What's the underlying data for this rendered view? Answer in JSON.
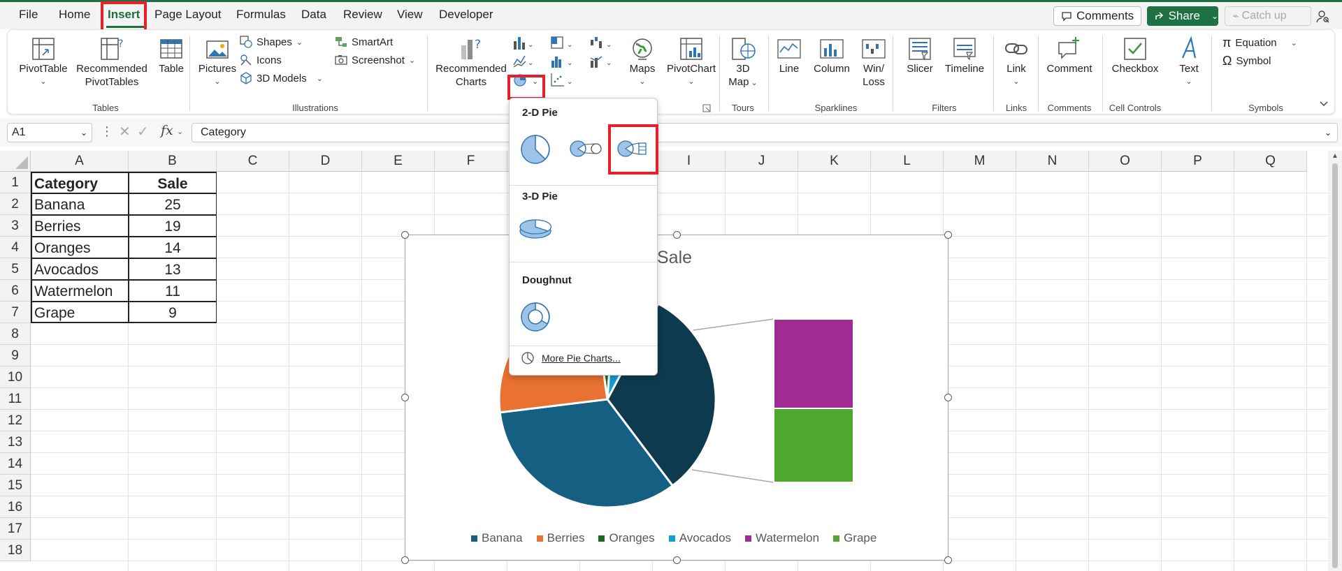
{
  "menu": {
    "tabs": [
      {
        "label": "File"
      },
      {
        "label": "Home"
      },
      {
        "label": "Insert"
      },
      {
        "label": "Page Layout"
      },
      {
        "label": "Formulas"
      },
      {
        "label": "Data"
      },
      {
        "label": "Review"
      },
      {
        "label": "View"
      },
      {
        "label": "Developer"
      }
    ],
    "comments_label": "Comments",
    "share_label": "Share",
    "catchup_label": "Catch up"
  },
  "ribbon": {
    "tables": {
      "group": "Tables",
      "pivot_table": "PivotTable",
      "recommended_pivot_1": "Recommended",
      "recommended_pivot_2": "PivotTables",
      "table": "Table"
    },
    "illustrations": {
      "group": "Illustrations",
      "pictures": "Pictures",
      "shapes": "Shapes",
      "icons": "Icons",
      "models": "3D Models",
      "smartart": "SmartArt",
      "screenshot": "Screenshot"
    },
    "charts": {
      "recommended_1": "Recommended",
      "recommended_2": "Charts",
      "maps": "Maps",
      "pivotchart": "PivotChart"
    },
    "tours": {
      "group": "Tours",
      "map_1": "3D",
      "map_2": "Map"
    },
    "sparklines": {
      "group": "Sparklines",
      "line": "Line",
      "column": "Column",
      "winloss_1": "Win/",
      "winloss_2": "Loss"
    },
    "filters": {
      "group": "Filters",
      "slicer": "Slicer",
      "timeline": "Timeline"
    },
    "links": {
      "group": "Links",
      "link": "Link"
    },
    "comments": {
      "group": "Comments",
      "comment": "Comment"
    },
    "cell_controls": {
      "group": "Cell Controls",
      "checkbox": "Checkbox"
    },
    "text": {
      "text": "Text"
    },
    "symbols": {
      "group": "Symbols",
      "equation": "Equation",
      "symbol": "Symbol"
    }
  },
  "formula_bar": {
    "name_box": "A1",
    "fx": "fx",
    "content": "Category"
  },
  "grid": {
    "columns": [
      "A",
      "B",
      "C",
      "D",
      "E",
      "F",
      "G",
      "H",
      "I",
      "J",
      "K",
      "L",
      "M",
      "N",
      "O",
      "P",
      "Q"
    ],
    "rows": [
      "1",
      "2",
      "3",
      "4",
      "5",
      "6",
      "7",
      "8",
      "9",
      "10",
      "11",
      "12",
      "13",
      "14",
      "15",
      "16",
      "17",
      "18"
    ],
    "header": {
      "category": "Category",
      "sale": "Sale"
    },
    "data": [
      {
        "category": "Banana",
        "sale": "25"
      },
      {
        "category": "Berries",
        "sale": "19"
      },
      {
        "category": "Oranges",
        "sale": "14"
      },
      {
        "category": "Avocados",
        "sale": "13"
      },
      {
        "category": "Watermelon",
        "sale": "11"
      },
      {
        "category": "Grape",
        "sale": "9"
      }
    ]
  },
  "chart": {
    "title": "Sale",
    "legend": [
      {
        "label": "Banana",
        "color": "#156082"
      },
      {
        "label": "Berries",
        "color": "#e97132"
      },
      {
        "label": "Oranges",
        "color": "#196b24"
      },
      {
        "label": "Avocados",
        "color": "#0f9ed5"
      },
      {
        "label": "Watermelon",
        "color": "#a02b93"
      },
      {
        "label": "Grape",
        "color": "#4ea72e"
      }
    ],
    "dark_slice_color": "#0e3a4f"
  },
  "dropdown": {
    "section_2d": "2-D Pie",
    "section_3d": "3-D Pie",
    "section_doughnut": "Doughnut",
    "more": "More Pie Charts..."
  }
}
